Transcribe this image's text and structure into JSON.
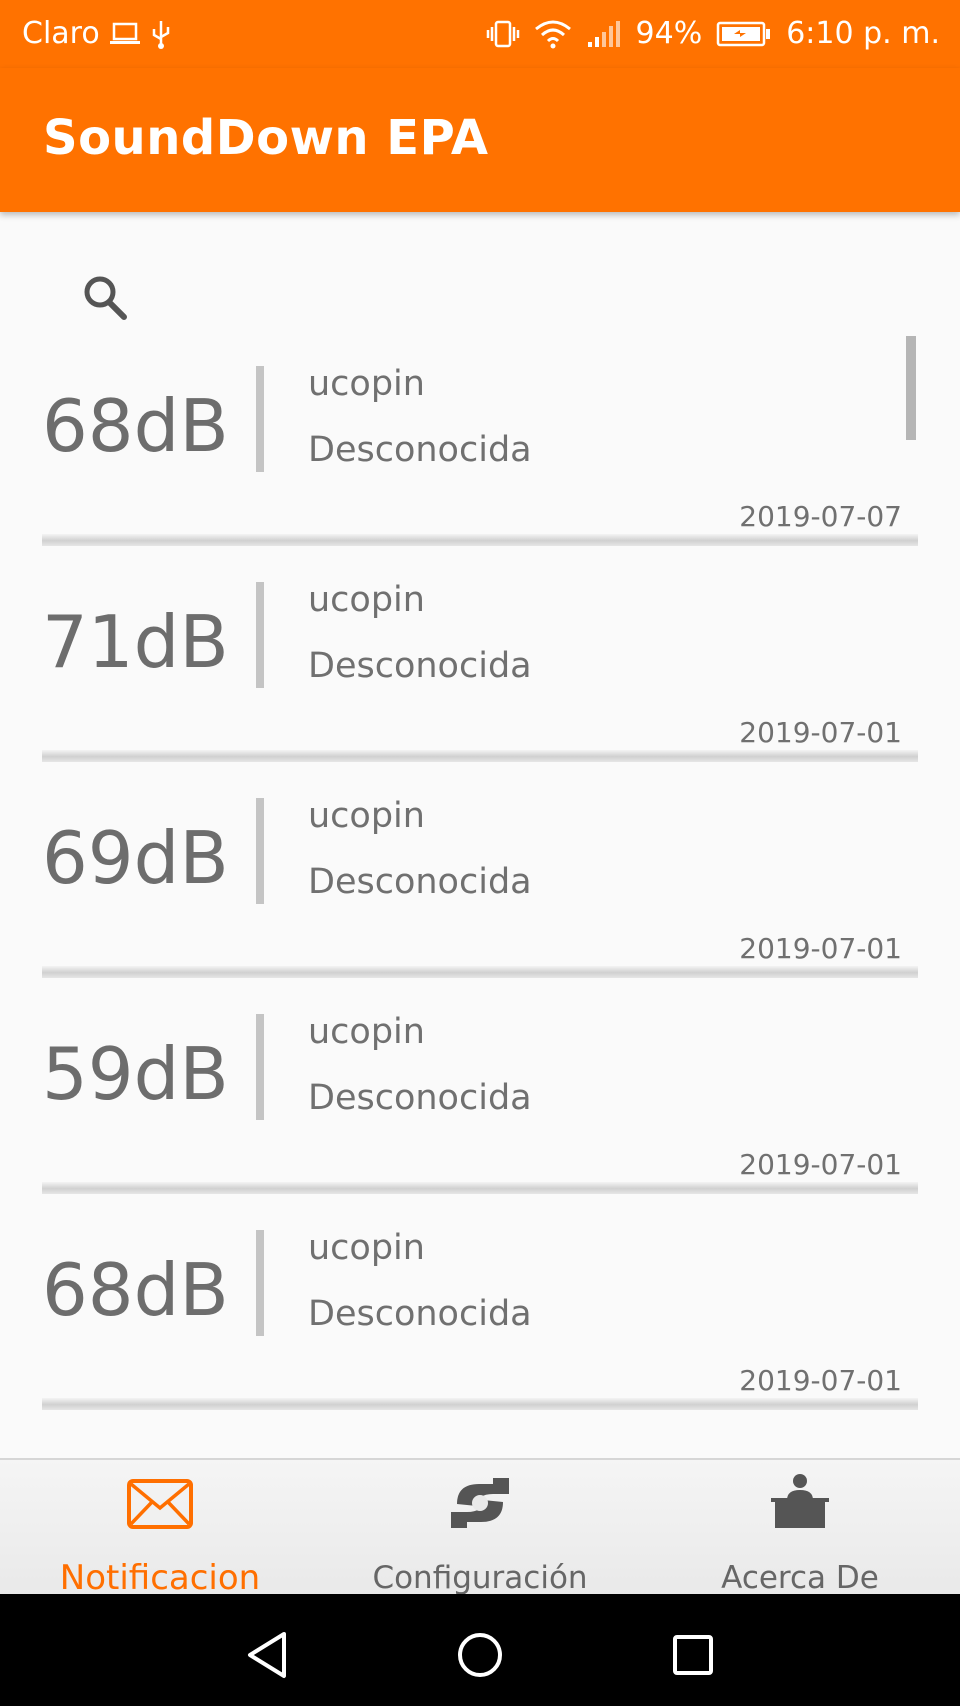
{
  "status_bar": {
    "carrier": "Claro",
    "battery": "94%",
    "time": "6:10 p. m."
  },
  "app_bar": {
    "title": "SoundDown EPA"
  },
  "search": {
    "icon": "search-icon"
  },
  "notifications": [
    {
      "level": "68dB",
      "user": "ucopin",
      "location": "Desconocida",
      "date": "2019-07-07"
    },
    {
      "level": "71dB",
      "user": "ucopin",
      "location": "Desconocida",
      "date": "2019-07-01"
    },
    {
      "level": "69dB",
      "user": "ucopin",
      "location": "Desconocida",
      "date": "2019-07-01"
    },
    {
      "level": "59dB",
      "user": "ucopin",
      "location": "Desconocida",
      "date": "2019-07-01"
    },
    {
      "level": "68dB",
      "user": "ucopin",
      "location": "Desconocida",
      "date": "2019-07-01"
    }
  ],
  "bottom_nav": {
    "items": [
      {
        "label": "Notificacion",
        "icon": "envelope-icon",
        "active": true
      },
      {
        "label": "Configuración",
        "icon": "settings-icon",
        "active": false
      },
      {
        "label": "Acerca De",
        "icon": "person-desk-icon",
        "active": false
      }
    ]
  },
  "colors": {
    "primary": "#ff7200",
    "active_tab": "#ff6f00",
    "text": "#707070"
  }
}
